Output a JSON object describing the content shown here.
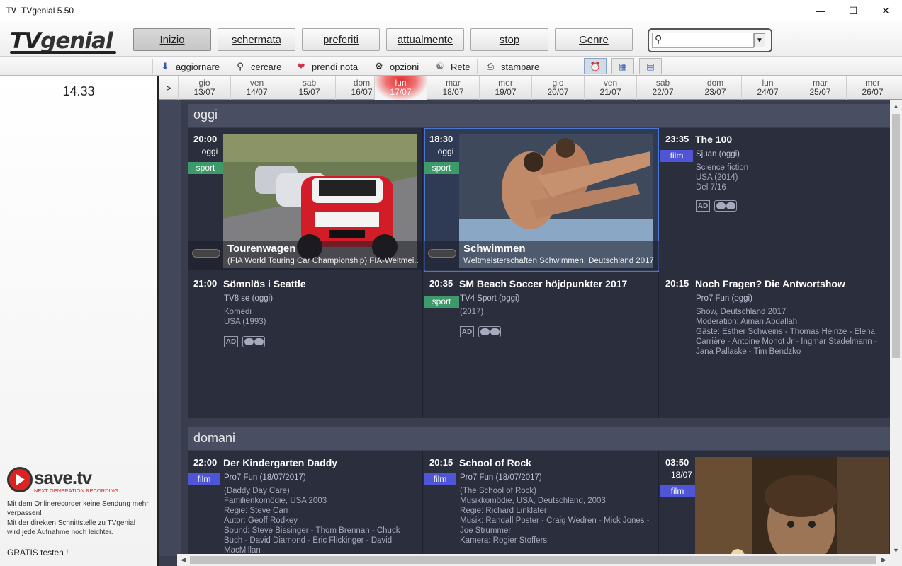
{
  "window": {
    "title": "TVgenial 5.50"
  },
  "logo": {
    "text_tv": "TV",
    "text_genial": "genial"
  },
  "nav": [
    {
      "label": "Inizio",
      "active": true
    },
    {
      "label": "schermata",
      "active": false
    },
    {
      "label": "preferiti",
      "active": false
    },
    {
      "label": "attualmente",
      "active": false
    },
    {
      "label": "stop",
      "active": false
    },
    {
      "label": "Genre",
      "active": false
    }
  ],
  "search": {
    "value": ""
  },
  "toolbar": [
    {
      "label": "aggiornare",
      "icon": "arrow-down-icon"
    },
    {
      "label": "cercare",
      "icon": "search-icon"
    },
    {
      "label": "prendi nota",
      "icon": "heart-icon"
    },
    {
      "label": "opzioni",
      "icon": "gear-icon"
    },
    {
      "label": "Rete",
      "icon": "network-icon"
    },
    {
      "label": "stampare",
      "icon": "printer-icon"
    }
  ],
  "clock": "14.33",
  "dates": [
    {
      "dn": "gio",
      "dd": "13/07"
    },
    {
      "dn": "ven",
      "dd": "14/07"
    },
    {
      "dn": "sab",
      "dd": "15/07"
    },
    {
      "dn": "dom",
      "dd": "16/07"
    },
    {
      "dn": "lun",
      "dd": "17/07",
      "today": true
    },
    {
      "dn": "mar",
      "dd": "18/07"
    },
    {
      "dn": "mer",
      "dd": "19/07"
    },
    {
      "dn": "gio",
      "dd": "20/07"
    },
    {
      "dn": "ven",
      "dd": "21/07"
    },
    {
      "dn": "sab",
      "dd": "22/07"
    },
    {
      "dn": "dom",
      "dd": "23/07"
    },
    {
      "dn": "lun",
      "dd": "24/07"
    },
    {
      "dn": "mar",
      "dd": "25/07"
    },
    {
      "dn": "mer",
      "dd": "26/07"
    }
  ],
  "date_arrow": ">",
  "sections": {
    "today": {
      "label": "oggi"
    },
    "tomorrow": {
      "label": "domani"
    }
  },
  "today_cards": {
    "c1": {
      "time": "20:00",
      "day": "oggi",
      "badge": "sport",
      "title": "Tourenwagen",
      "subtitle": "(FIA World Touring Car Championship)  FIA-Weltmei..."
    },
    "c2": {
      "time": "18:30",
      "day": "oggi",
      "badge": "sport",
      "title": "Schwimmen",
      "subtitle": "Weltmeisterschaften  Schwimmen, Deutschland 2017"
    },
    "c3": {
      "time": "23:35",
      "badge": "film",
      "title": "The 100",
      "channel": "Sjuan  (oggi)",
      "lines": [
        "Science fiction",
        "USA (2014)",
        "Del 7/16"
      ],
      "ad": "AD"
    },
    "c4": {
      "time": "21:00",
      "title": "Sömnlös i Seattle",
      "channel": "TV8 se  (oggi)",
      "lines": [
        "Komedi",
        "USA (1993)"
      ],
      "ad": "AD"
    },
    "c5": {
      "time": "20:35",
      "badge": "sport",
      "title": "SM Beach Soccer höjdpunkter 2017",
      "channel": "TV4 Sport  (oggi)",
      "lines": [
        "(2017)"
      ],
      "ad": "AD"
    },
    "c6": {
      "time": "20:15",
      "title": "Noch Fragen? Die Antwortshow",
      "channel": "Pro7 Fun  (oggi)",
      "lines": [
        "Show, Deutschland 2017",
        "Moderation: Aiman Abdallah",
        "Gäste: Esther Schweins - Thomas Heinze - Elena Carrière - Antoine Monot Jr - Ingmar Stadelmann - Jana Pallaske - Tim Bendzko"
      ]
    }
  },
  "tomorrow_cards": {
    "c1": {
      "time": "22:00",
      "badge": "film",
      "title": "Der Kindergarten Daddy",
      "channel": "Pro7 Fun  (18/07/2017)",
      "lines": [
        "(Daddy Day Care)",
        "Familienkomödie, USA 2003",
        "Regie: Steve Carr",
        "Autor: Geoff Rodkey",
        "Sound: Steve Bissinger - Thom Brennan - Chuck Buch - David Diamond - Eric Flickinger - David MacMillan"
      ]
    },
    "c2": {
      "time": "20:15",
      "badge": "film",
      "title": "School of Rock",
      "channel": "Pro7 Fun  (18/07/2017)",
      "lines": [
        "(The School of Rock)",
        "Musikkomödie, USA, Deutschland,  2003",
        "Regie: Richard Linklater",
        "Musik: Randall Poster - Craig Wedren - Mick Jones - Joe Strummer",
        "Kamera: Rogier Stoffers"
      ]
    },
    "c3": {
      "time": "03:50",
      "day": "18/07",
      "badge": "film"
    }
  },
  "savetv": {
    "brand": "save.tv",
    "tagline": "NEXT GENERATION RECORDING",
    "promo1": "Mit dem Onlinerecorder keine Sendung mehr verpassen!",
    "promo2": "Mit der direkten Schnittstelle zu TVgenial wird jede Aufnahme noch leichter.",
    "cta": "GRATIS testen !"
  },
  "colors": {
    "sport": "#3f9a6b",
    "film": "#5055d6",
    "background": "#3a3d4d",
    "today_marker": "#e03030"
  }
}
